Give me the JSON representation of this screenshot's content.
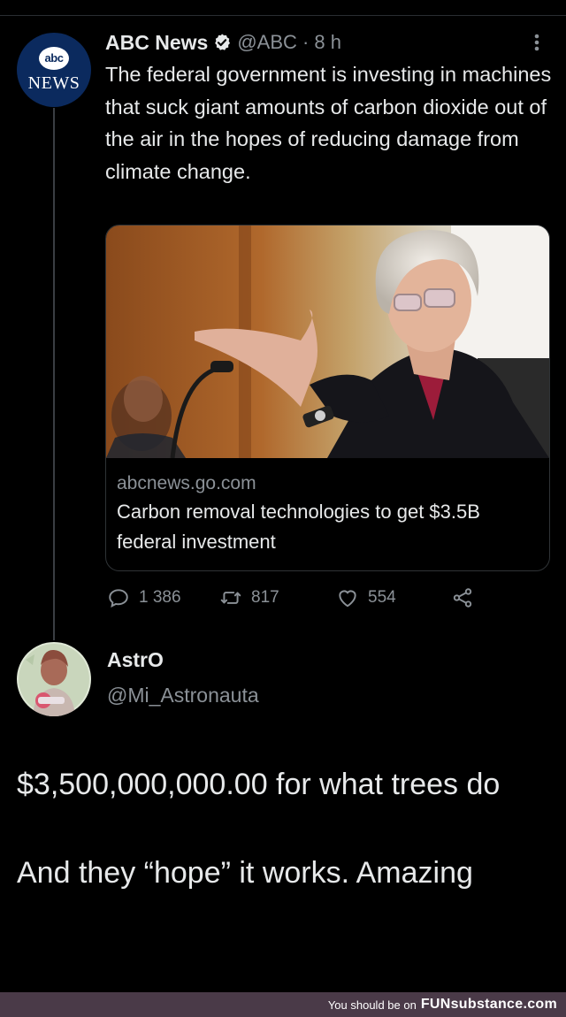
{
  "tweet": {
    "avatar_top": "abc",
    "avatar_bottom": "NEWS",
    "author_name": "ABC News",
    "handle_time": "@ABC · 8 h",
    "text": "The federal government is investing in machines that suck giant amounts of carbon dioxide out of the air in the hopes of reducing damage from climate change.",
    "card": {
      "domain": "abcnews.go.com",
      "title": "Carbon removal technologies to get $3.5B federal investment"
    },
    "actions": {
      "replies": "1 386",
      "retweets": "817",
      "likes": "554"
    }
  },
  "reply": {
    "author_name": "AstrO",
    "handle": "@Mi_Astronauta",
    "line1": "$3,500,000,000.00 for what trees do",
    "line2": "And they “hope” it works. Amazing"
  },
  "footer": {
    "text": "You should be on",
    "brand": "FUNsubstance.com"
  },
  "colors": {
    "background": "#000000",
    "text": "#e7e9ea",
    "secondary": "#8b9197",
    "footer_bg": "#4a3a48"
  }
}
